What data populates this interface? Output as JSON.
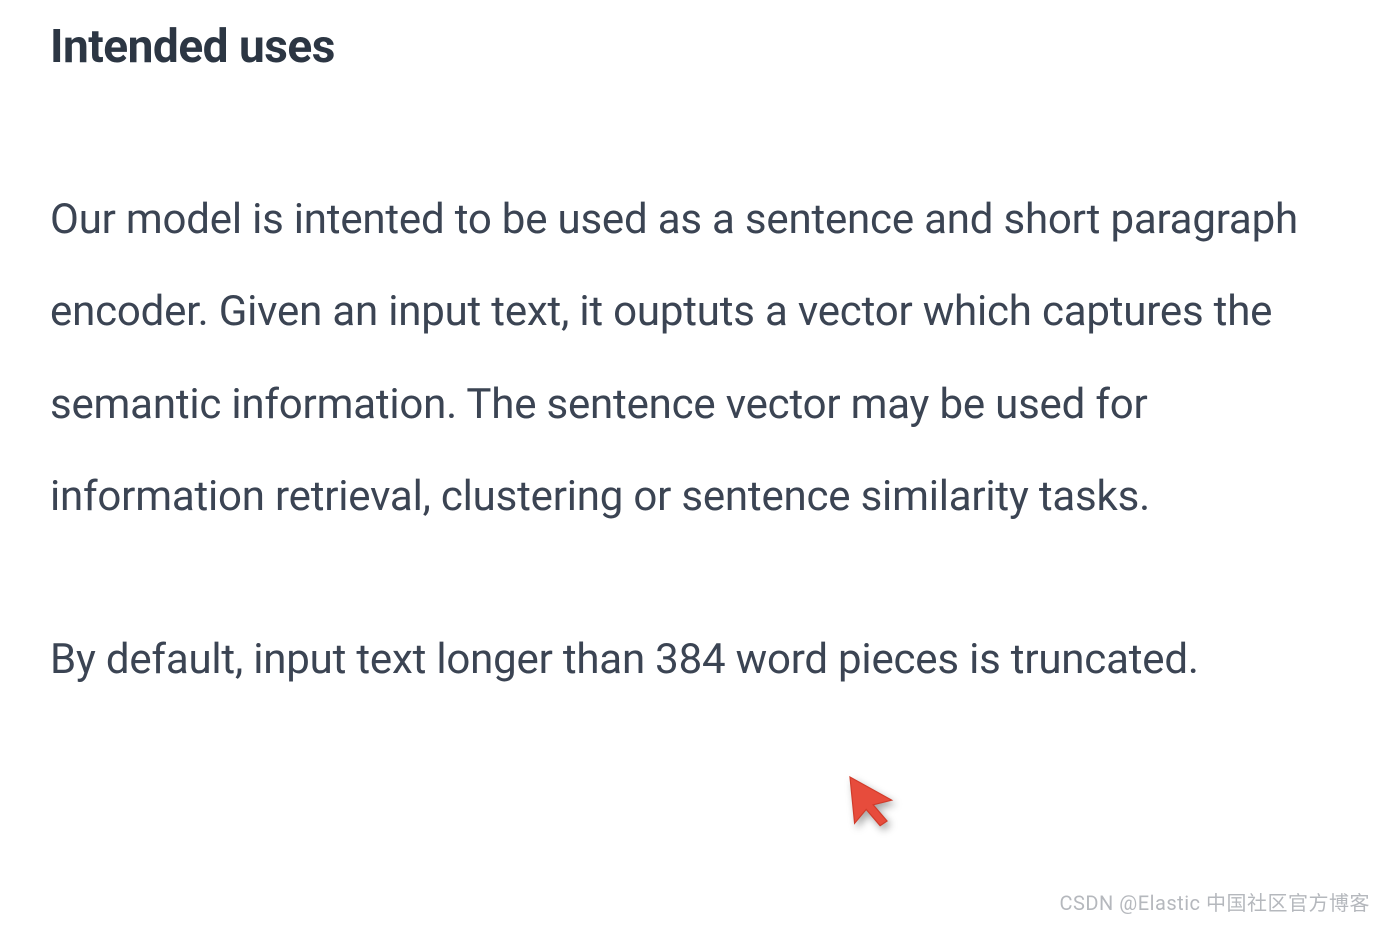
{
  "heading": "Intended uses",
  "paragraph1": "Our model is intented to be used as a sentence and short paragraph encoder. Given an input text, it ouptuts a vector which captures the semantic information. The sentence vector may be used for information retrieval, clustering or sentence similarity tasks.",
  "paragraph2": "By default, input text longer than 384 word pieces is truncated.",
  "watermark": "CSDN @Elastic 中国社区官方博客",
  "cursor_color": "#e74c3c"
}
